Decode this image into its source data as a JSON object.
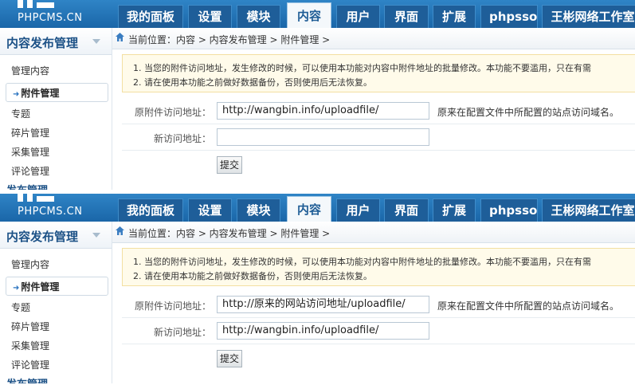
{
  "brand": {
    "logo_text": "PHPCMS.CN"
  },
  "nav_tabs": [
    "我的面板",
    "设置",
    "模块",
    "内容",
    "用户",
    "界面",
    "扩展",
    "phpsso",
    "王彬网络工作室"
  ],
  "sidebar": {
    "title": "内容发布管理",
    "items": [
      "管理内容",
      "附件管理",
      "专题",
      "碎片管理",
      "采集管理",
      "评论管理",
      "发布管理"
    ]
  },
  "breadcrumb": "当前位置：内容 > 内容发布管理 > 附件管理 >",
  "notice": [
    "1. 当您的附件访问地址，发生修改的时候，可以使用本功能对内容中附件地址的批量修改。本功能不要滥用，只在有需",
    "2. 请在使用本功能之前做好数据备份，否则使用后无法恢复。"
  ],
  "form": {
    "old_label": "原附件访问地址：",
    "new_label": "新访问地址：",
    "hint": "原来在配置文件中所配置的站点访问域名。",
    "submit": "提交"
  },
  "panels": [
    {
      "old_value": "http://wangbin.info/uploadfile/",
      "new_value": ""
    },
    {
      "old_value": "http://原来的网站访问地址/uploadfile/",
      "new_value": "http://wangbin.info/uploadfile/"
    }
  ]
}
